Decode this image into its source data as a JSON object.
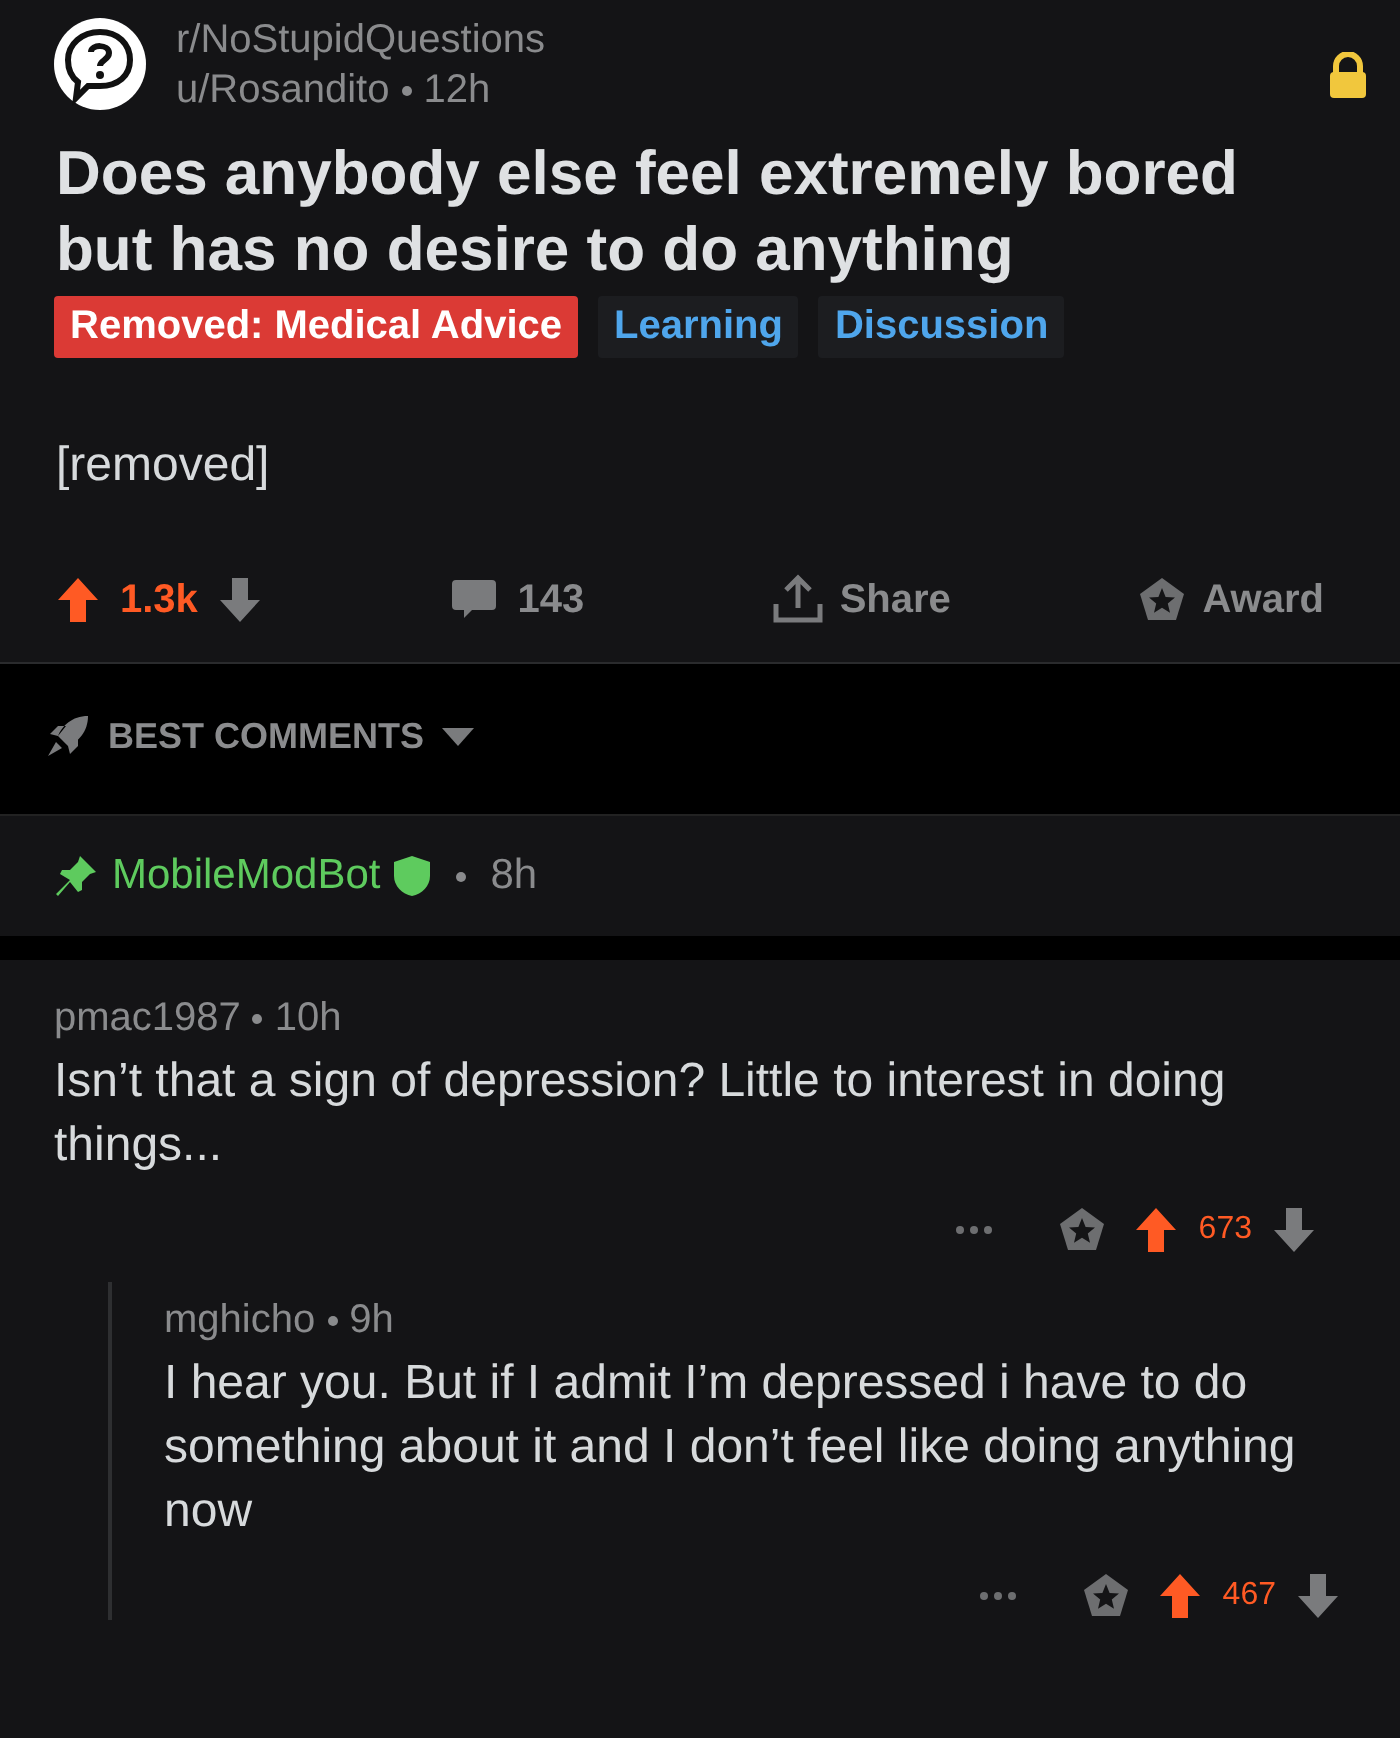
{
  "post": {
    "subreddit": "r/NoStupidQuestions",
    "author": "u/Rosandito",
    "age": "12h",
    "locked": true,
    "title": "Does anybody else feel extremely bored but has no desire to do anything",
    "flairs": [
      {
        "kind": "removed",
        "label": "Removed: Medical Advice"
      },
      {
        "kind": "tag",
        "label": "Learning"
      },
      {
        "kind": "tag",
        "label": "Discussion"
      }
    ],
    "body": "[removed]",
    "score": "1.3k",
    "upvoted": true,
    "comments": "143",
    "share": "Share",
    "award": "Award"
  },
  "sort": {
    "label": "BEST COMMENTS"
  },
  "pinned": {
    "author": "MobileModBot",
    "age": "8h",
    "moderator": true
  },
  "comments": [
    {
      "author": "pmac1987",
      "age": "10h",
      "text": "Isn’t that a sign of depression? Little to interest in doing things...",
      "score": "673",
      "upvoted": true,
      "children": [
        {
          "author": "mghicho",
          "age": "9h",
          "text": "I hear you. But if I admit I’m depressed i have to do something about it and I don’t feel like doing anything now",
          "score": "467",
          "upvoted": true
        }
      ]
    }
  ]
}
